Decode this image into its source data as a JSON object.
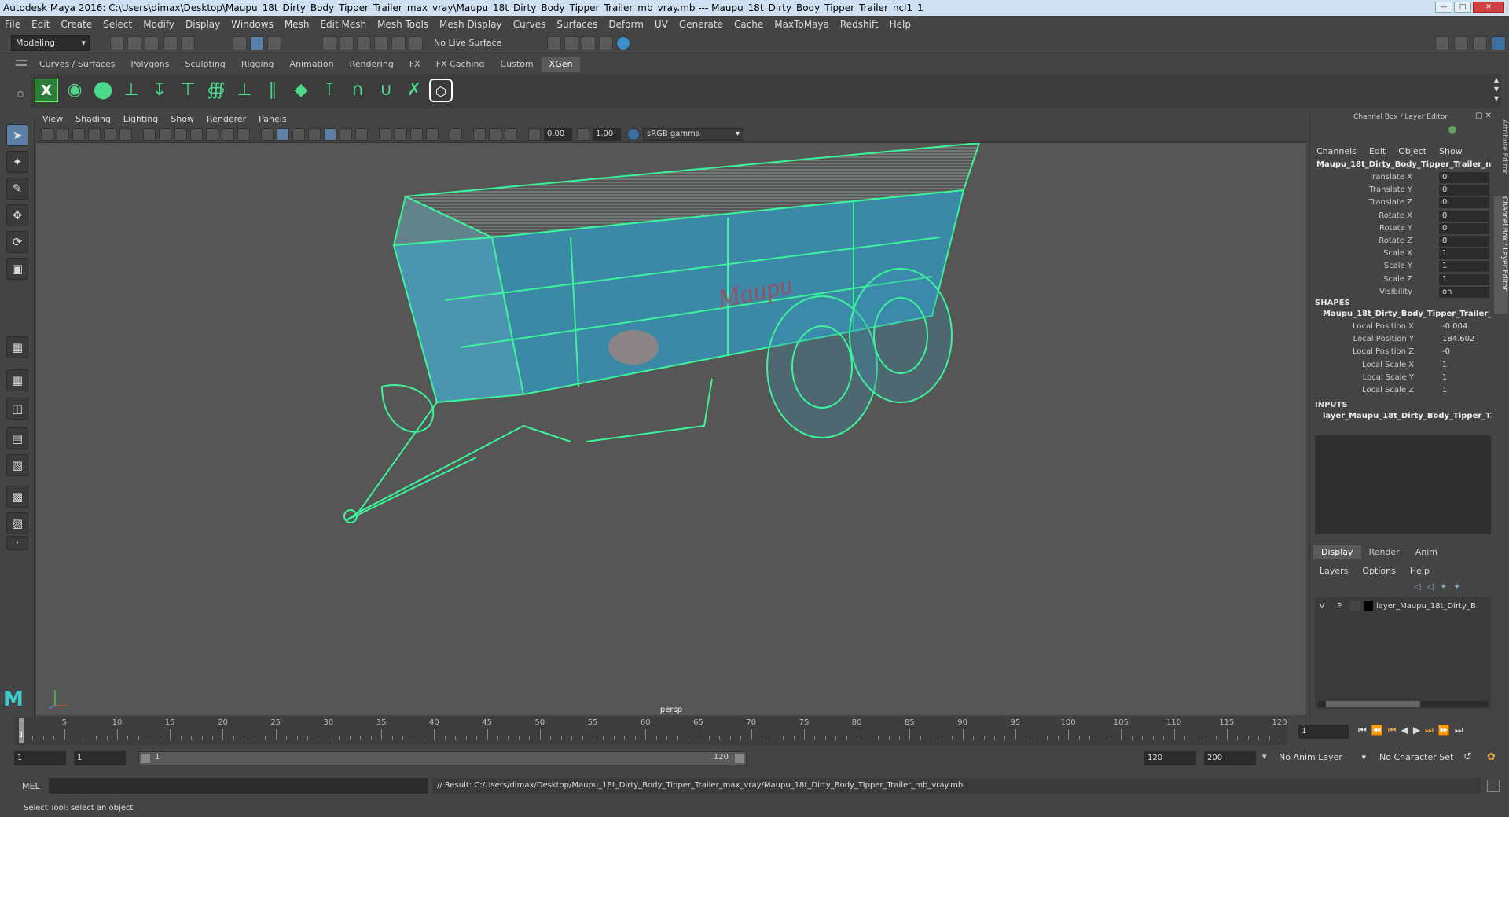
{
  "window": {
    "title": "Autodesk Maya 2016: C:\\Users\\dimax\\Desktop\\Maupu_18t_Dirty_Body_Tipper_Trailer_max_vray\\Maupu_18t_Dirty_Body_Tipper_Trailer_mb_vray.mb   ---   Maupu_18t_Dirty_Body_Tipper_Trailer_ncl1_1"
  },
  "menu": [
    "File",
    "Edit",
    "Create",
    "Select",
    "Modify",
    "Display",
    "Windows",
    "Mesh",
    "Edit Mesh",
    "Mesh Tools",
    "Mesh Display",
    "Curves",
    "Surfaces",
    "Deform",
    "UV",
    "Generate",
    "Cache",
    "MaxToMaya",
    "Redshift",
    "Help"
  ],
  "status": {
    "mode": "Modeling",
    "live_surface": "No Live Surface"
  },
  "shelf_tabs": [
    "Curves / Surfaces",
    "Polygons",
    "Sculpting",
    "Rigging",
    "Animation",
    "Rendering",
    "FX",
    "FX Caching",
    "Custom",
    "XGen"
  ],
  "shelf_active": "XGen",
  "viewport": {
    "menu": [
      "View",
      "Shading",
      "Lighting",
      "Show",
      "Renderer",
      "Panels"
    ],
    "exposure": "0.00",
    "gamma": "1.00",
    "color_space": "sRGB gamma",
    "camera": "persp",
    "decal_text": "Maupu"
  },
  "channel_box": {
    "header": "Channel Box / Layer Editor",
    "menu": [
      "Channels",
      "Edit",
      "Object",
      "Show"
    ],
    "object": "Maupu_18t_Dirty_Body_Tipper_Trailer_n...",
    "attrs": [
      {
        "label": "Translate X",
        "value": "0"
      },
      {
        "label": "Translate Y",
        "value": "0"
      },
      {
        "label": "Translate Z",
        "value": "0"
      },
      {
        "label": "Rotate X",
        "value": "0"
      },
      {
        "label": "Rotate Y",
        "value": "0"
      },
      {
        "label": "Rotate Z",
        "value": "0"
      },
      {
        "label": "Scale X",
        "value": "1"
      },
      {
        "label": "Scale Y",
        "value": "1"
      },
      {
        "label": "Scale Z",
        "value": "1"
      },
      {
        "label": "Visibility",
        "value": "on"
      }
    ],
    "shapes_title": "SHAPES",
    "shape_name": "Maupu_18t_Dirty_Body_Tipper_Trailer_...",
    "shape_attrs": [
      {
        "label": "Local Position X",
        "value": "-0.004"
      },
      {
        "label": "Local Position Y",
        "value": "184.602"
      },
      {
        "label": "Local Position Z",
        "value": "-0"
      },
      {
        "label": "Local Scale X",
        "value": "1"
      },
      {
        "label": "Local Scale Y",
        "value": "1"
      },
      {
        "label": "Local Scale Z",
        "value": "1"
      }
    ],
    "inputs_title": "INPUTS",
    "input_name": "layer_Maupu_18t_Dirty_Body_Tipper_T...",
    "side_tabs": [
      "Attribute Editor",
      "Channel Box / Layer Editor"
    ]
  },
  "layer_editor": {
    "tabs": [
      "Display",
      "Render",
      "Anim"
    ],
    "menu": [
      "Layers",
      "Options",
      "Help"
    ],
    "layer": {
      "v": "V",
      "p": "P",
      "name": "layer_Maupu_18t_Dirty_B"
    }
  },
  "timeline": {
    "ticks": [
      "5",
      "10",
      "15",
      "20",
      "25",
      "30",
      "35",
      "40",
      "45",
      "50",
      "55",
      "60",
      "65",
      "70",
      "75",
      "80",
      "85",
      "90",
      "95",
      "100",
      "105",
      "110",
      "115",
      "120"
    ],
    "current": "1",
    "current_field": "1"
  },
  "range": {
    "start": "1",
    "start2": "1",
    "slider_start": "1",
    "slider_end": "120",
    "end": "120",
    "end2": "200",
    "anim_layer": "No Anim Layer",
    "char_set": "No Character Set"
  },
  "cmd": {
    "label": "MEL",
    "result": "// Result: C:/Users/dimax/Desktop/Maupu_18t_Dirty_Body_Tipper_Trailer_max_vray/Maupu_18t_Dirty_Body_Tipper_Trailer_mb_vray.mb"
  },
  "help_line": "Select Tool: select an object"
}
